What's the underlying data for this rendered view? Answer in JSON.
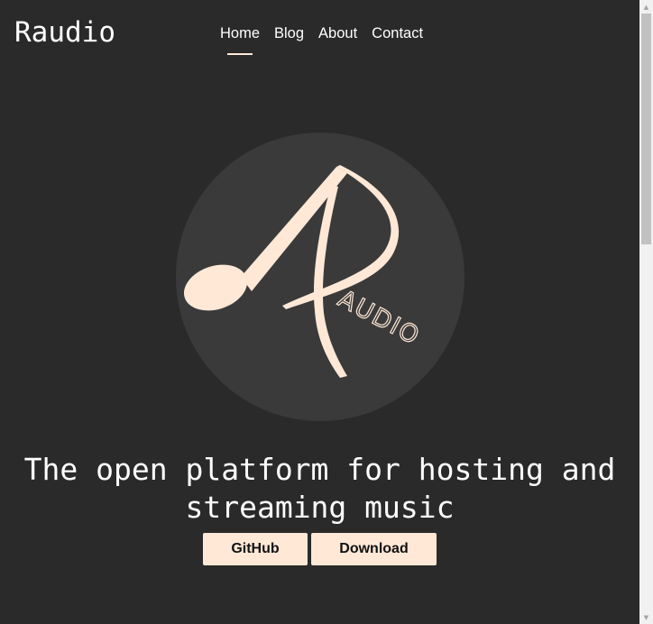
{
  "header": {
    "brand": "Raudio",
    "nav": [
      {
        "label": "Home",
        "active": true
      },
      {
        "label": "Blog",
        "active": false
      },
      {
        "label": "About",
        "active": false
      },
      {
        "label": "Contact",
        "active": false
      }
    ]
  },
  "hero": {
    "logo_text": "AUDIO",
    "headline_line1": "The open platform for hosting and",
    "headline_line2": "streaming music",
    "buttons": {
      "github_label": "GitHub",
      "download_label": "Download"
    }
  },
  "colors": {
    "background": "#2a2a2a",
    "logo_circle": "#3a3a3a",
    "accent": "#ffe8d6",
    "text": "#ffffff"
  },
  "icons": {
    "logo": "raudio-music-note-logo",
    "scroll_up": "scroll-up-arrow-icon",
    "scroll_down": "scroll-down-arrow-icon"
  }
}
